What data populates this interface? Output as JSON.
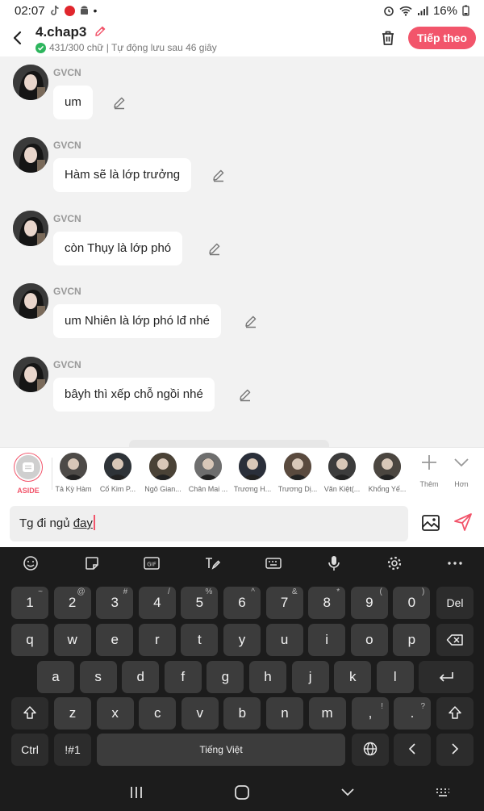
{
  "status_bar": {
    "time": "02:07",
    "battery": "16%"
  },
  "header": {
    "title": "4.chap3",
    "subtitle": "431/300 chữ | Tự động lưu sau 46 giây",
    "next_label": "Tiếp theo"
  },
  "messages": [
    {
      "sender": "GVCN",
      "text": "um"
    },
    {
      "sender": "GVCN",
      "text": "Hàm sẽ là lớp trưởng"
    },
    {
      "sender": "GVCN",
      "text": "còn Thụy là lớp phó"
    },
    {
      "sender": "GVCN",
      "text": "um Nhiên là lớp phó lđ nhé"
    },
    {
      "sender": "GVCN",
      "text": "bâyh thì xếp chỗ ngồi nhé"
    }
  ],
  "characters": {
    "aside_label": "ASIDE",
    "items": [
      {
        "name": "Tả Kỳ Hàm"
      },
      {
        "name": "Cố Kim P..."
      },
      {
        "name": "Ngô Gian..."
      },
      {
        "name": "Chân Mai ..."
      },
      {
        "name": "Trương H..."
      },
      {
        "name": "Trương Dị..."
      },
      {
        "name": "Văn Kiệt(..."
      },
      {
        "name": "Khổng Yế..."
      }
    ],
    "more_label": "Thêm",
    "less_label": "Hơn"
  },
  "input": {
    "text_plain": "Tg đi ngủ ",
    "text_underlined": "đay"
  },
  "keyboard": {
    "row1": [
      {
        "k": "1",
        "s": "~"
      },
      {
        "k": "2",
        "s": "@"
      },
      {
        "k": "3",
        "s": "#"
      },
      {
        "k": "4",
        "s": "/"
      },
      {
        "k": "5",
        "s": "%"
      },
      {
        "k": "6",
        "s": "^"
      },
      {
        "k": "7",
        "s": "&"
      },
      {
        "k": "8",
        "s": "*"
      },
      {
        "k": "9",
        "s": "("
      },
      {
        "k": "0",
        "s": ")"
      }
    ],
    "del_label": "Del",
    "row2": [
      "q",
      "w",
      "e",
      "r",
      "t",
      "y",
      "u",
      "i",
      "o",
      "p"
    ],
    "row3": [
      "a",
      "s",
      "d",
      "f",
      "g",
      "h",
      "j",
      "k",
      "l"
    ],
    "row4": [
      "z",
      "x",
      "c",
      "v",
      "b",
      "n",
      "m"
    ],
    "comma": {
      "k": ",",
      "s": "!"
    },
    "period": {
      "k": ".",
      "s": "?"
    },
    "ctrl_label": "Ctrl",
    "sym_label": "!#1",
    "space_label": "Tiếng Việt"
  },
  "colors": {
    "accent": "#f2556b",
    "keyboard_bg": "#1c1c1c",
    "key_bg": "#3c3c3c",
    "check": "#2db55d"
  }
}
